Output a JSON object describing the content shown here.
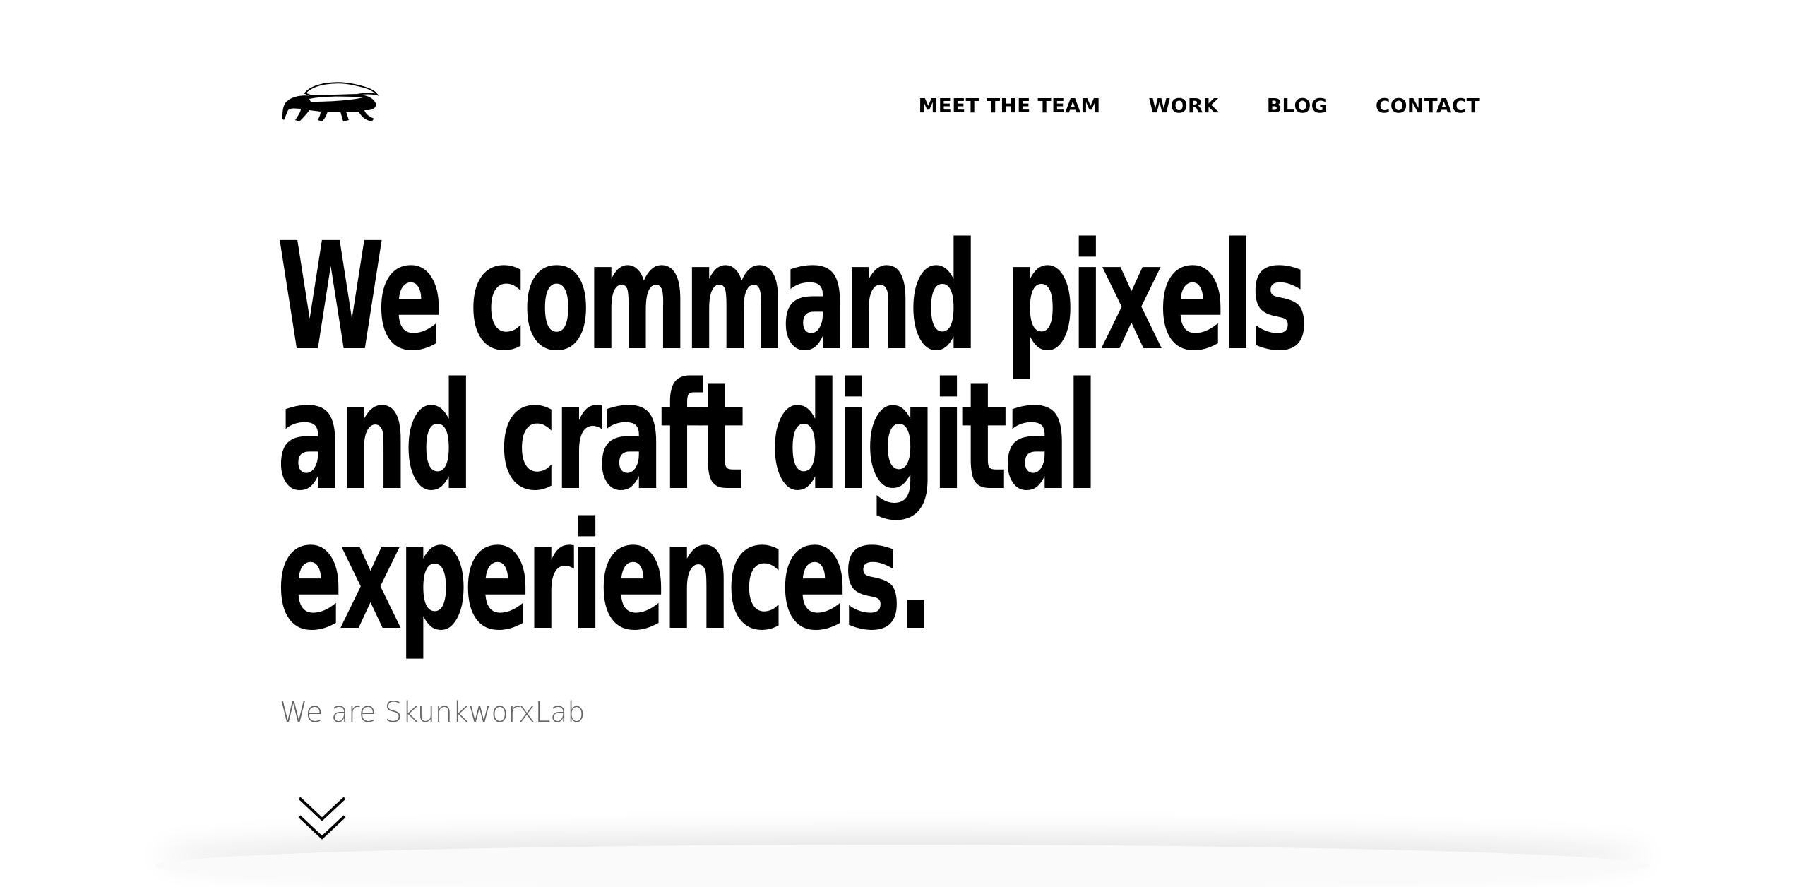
{
  "header": {
    "logo_icon": "skunk-logo-icon",
    "nav": [
      {
        "label": "MEET THE TEAM"
      },
      {
        "label": "WORK"
      },
      {
        "label": "BLOG"
      },
      {
        "label": "CONTACT"
      }
    ]
  },
  "hero": {
    "headline_lines": [
      "We command pixels",
      "and craft digital",
      "experiences."
    ],
    "tagline": "We are SkunkworxLab",
    "scroll_icon": "double-chevron-down-icon"
  },
  "colors": {
    "text": "#000000",
    "background": "#ffffff",
    "tagline": "#555555"
  }
}
